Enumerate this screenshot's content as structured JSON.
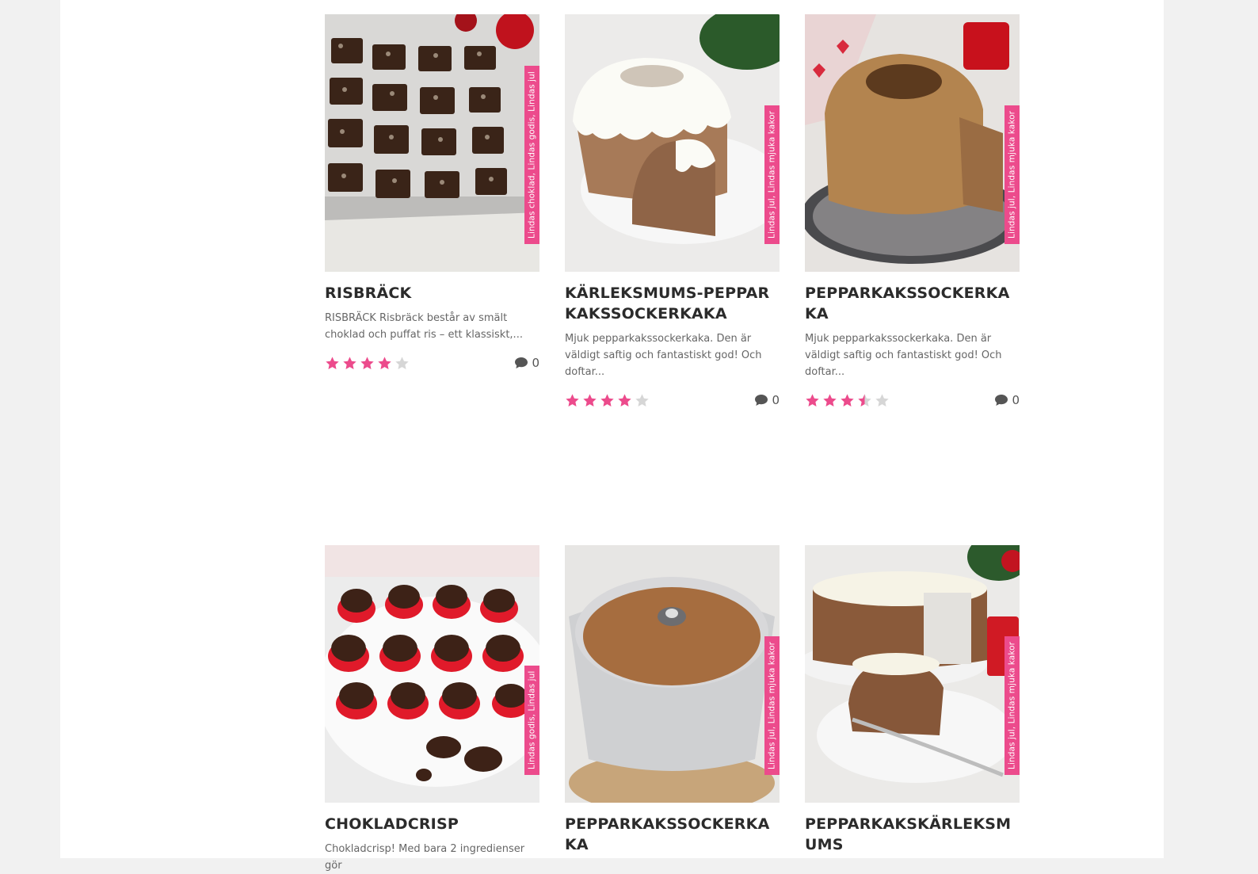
{
  "colors": {
    "accent": "#ec4b8c",
    "star_on": "#ec4b8c",
    "star_off": "#d6d6d6",
    "text": "#2b2b2b"
  },
  "cards": [
    {
      "title": "RISBRÄCK",
      "categories": "Lindas choklad, Lindas godis, Lindas jul",
      "excerpt": "RISBRÄCK Risbräck består av smält choklad och puffat ris – ett klassiskt,...",
      "rating": 4,
      "comments": "0"
    },
    {
      "title": "KÄRLEKSMUMS-PEPPARKAKSSOCKERKAKA",
      "categories": "Lindas jul, Lindas mjuka kakor",
      "excerpt": "Mjuk pepparkakssockerkaka. Den är väldigt saftig och fantastiskt god! Och doftar...",
      "rating": 4,
      "comments": "0"
    },
    {
      "title": "PEPPARKAKSSOCKERKAKA",
      "categories": "Lindas jul, Lindas mjuka kakor",
      "excerpt": "Mjuk pepparkakssockerkaka. Den är väldigt saftig och fantastiskt god! Och doftar...",
      "rating": 3.5,
      "comments": "0"
    },
    {
      "title": "CHOKLADCRISP",
      "categories": "Lindas godis, Lindas jul",
      "excerpt": "Chokladcrisp! Med bara 2 ingredienser gör",
      "rating": null,
      "comments": null
    },
    {
      "title": "PEPPARKAKSSOCKERKAKA",
      "categories": "Lindas jul, Lindas mjuka kakor",
      "excerpt": "",
      "rating": null,
      "comments": null
    },
    {
      "title": "PEPPARKAKSKÄRLEKSMUMS",
      "categories": "Lindas jul, Lindas mjuka kakor",
      "excerpt": "",
      "rating": null,
      "comments": null
    }
  ]
}
